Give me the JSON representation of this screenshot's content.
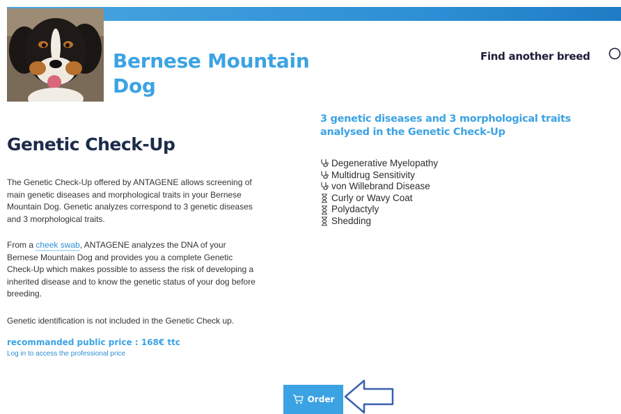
{
  "header": {
    "breed_line1": "Bernese Mountain",
    "breed_line2": "Dog",
    "find_breed_label": "Find another breed"
  },
  "checkup": {
    "title": "Genetic Check-Up",
    "paragraph1": "The Genetic Check-Up offered by ANTAGENE allows screening of main genetic diseases and morphological traits in your Bernese Mountain Dog. Genetic analyzes correspond to 3 genetic diseases and 3 morphological traits.",
    "paragraph2_before": "From a ",
    "paragraph2_link": "cheek swab",
    "paragraph2_after": ", ANTAGENE analyzes the DNA of your Bernese Mountain Dog and provides you a complete Genetic Check-Up which makes possible to assess the risk of developing a inherited disease and to know the genetic status of your dog before breeding.",
    "paragraph3": "Genetic identification is not included in the Genetic Check up.",
    "price": "recommanded public price : 168€ ttc",
    "pro_price_link": "Log in to access the professional price"
  },
  "analysis": {
    "title": "3 genetic diseases and 3 morphological traits analysed in the Genetic Check-Up",
    "diseases": [
      "Degenerative Myelopathy",
      "Multidrug Sensitivity",
      "von Willebrand Disease"
    ],
    "traits": [
      "Curly or Wavy Coat",
      "Polydactyly",
      "Shedding"
    ]
  },
  "order": {
    "label": "Order"
  },
  "icons": {
    "disease": "stethoscope-icon",
    "trait": "hourglass-icon",
    "search": "search-icon",
    "cart": "cart-icon",
    "annotation": "arrow-left-icon"
  },
  "colors": {
    "accent": "#3ca3e3",
    "heading": "#1d2b4a",
    "arrow": "#3a5fb0"
  }
}
